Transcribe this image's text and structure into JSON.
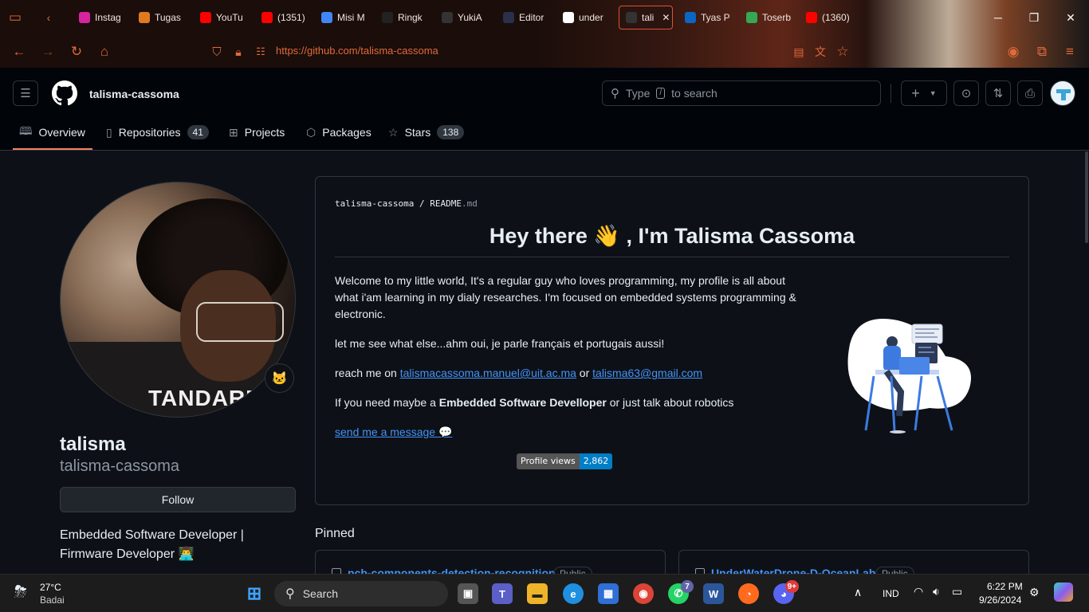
{
  "browser": {
    "tabs": [
      {
        "label": "Instag",
        "icon": "instagram-icon",
        "color": "#d6249f"
      },
      {
        "label": "Tugas",
        "icon": "tugas-icon",
        "color": "#e07a1f"
      },
      {
        "label": "YouTu",
        "icon": "youtube-icon",
        "color": "#ff0000"
      },
      {
        "label": "(1351)",
        "icon": "youtube-icon",
        "color": "#ff0000"
      },
      {
        "label": "Misi M",
        "icon": "docs-icon",
        "color": "#4285f4"
      },
      {
        "label": "Ringk",
        "icon": "mk-icon",
        "color": "#222222"
      },
      {
        "label": "YukiA",
        "icon": "github-icon",
        "color": "#333333"
      },
      {
        "label": "Editor",
        "icon": "d-icon",
        "color": "#2a2f4a"
      },
      {
        "label": "under",
        "icon": "google-icon",
        "color": "#ffffff"
      },
      {
        "label": "tali",
        "icon": "github-icon",
        "color": "#333333"
      },
      {
        "label": "Tyas P",
        "icon": "linkedin-icon",
        "color": "#0a66c2"
      },
      {
        "label": "Toserb",
        "icon": "maps-icon",
        "color": "#34a853"
      },
      {
        "label": "(1360)",
        "icon": "youtube-icon",
        "color": "#ff0000"
      }
    ],
    "url_host": "https://github.com/",
    "url_path": "talisma-cassoma"
  },
  "header": {
    "username": "talisma-cassoma",
    "search_placeholder_pre": "Type",
    "search_key": "/",
    "search_placeholder_post": "to search",
    "plus_label": "+"
  },
  "profile_tabs": {
    "overview": "Overview",
    "repositories": "Repositories",
    "repositories_count": "41",
    "projects": "Projects",
    "packages": "Packages",
    "stars": "Stars",
    "stars_count": "138"
  },
  "profile": {
    "display_name": "talisma",
    "login": "talisma-cassoma",
    "follow_label": "Follow",
    "bio": "Embedded Software Developer | Firmware Developer 👨‍💻",
    "avatar_text": "TANDARD",
    "status_emoji": "🐱"
  },
  "readme": {
    "path_user": "talisma-cassoma",
    "path_sep": "/",
    "path_file": "README",
    "path_ext": ".md",
    "title": "Hey there 👋 , I'm Talisma Cassoma",
    "para1": "Welcome to my little world, It's a regular guy who loves programming, my profile is all about what i'am learning in my dialy researches. I'm focused on embedded systems programming & electronic.",
    "para2": "let me see what else...ahm oui, je parle français et portugais aussi!",
    "para3_pre": "reach me on ",
    "email1": "talismacassoma.manuel@uit.ac.ma",
    "para3_mid": " or ",
    "email2": "talisma63@gmail.com",
    "para4_pre": "If you need maybe a ",
    "para4_bold": "Embedded Software Develloper",
    "para4_post": " or just talk about robotics",
    "send_message": "send me a message 💬",
    "views_label": "Profile views",
    "views_count": "2,862"
  },
  "pinned": {
    "title": "Pinned",
    "items": [
      {
        "name": "pcb-components-detection-recognition",
        "visibility": "Public"
      },
      {
        "name": "UnderWaterDrone-D-OceanLab",
        "visibility": "Public"
      }
    ]
  },
  "taskbar": {
    "weather_temp": "27°C",
    "weather_desc": "Badai",
    "search_label": "Search",
    "teams_badge": "7",
    "discord_badge": "9+",
    "lang": "IND",
    "time": "6:22 PM",
    "date": "9/26/2024"
  }
}
